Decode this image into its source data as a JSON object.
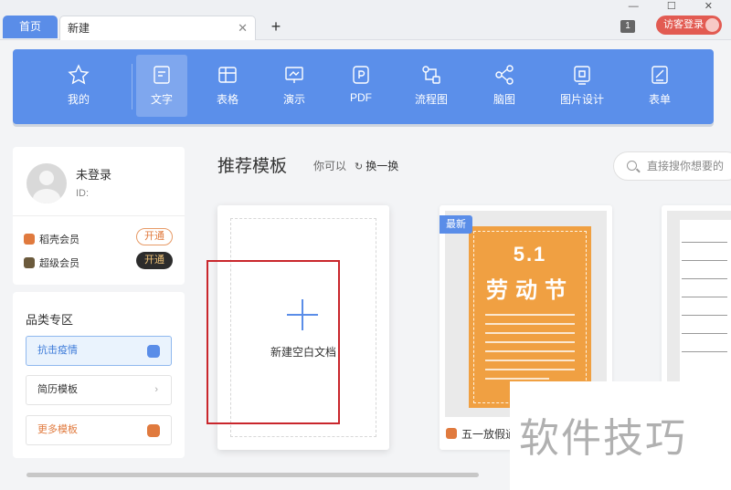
{
  "tabs": {
    "home": "首页",
    "new": "新建",
    "close_glyph": "✕",
    "add_glyph": "+"
  },
  "header": {
    "badge_count": "1",
    "guest_login": "访客登录",
    "window_controls": "— ☐ ✕"
  },
  "toolbar": {
    "items": [
      {
        "label": "我的",
        "icon": "star-icon"
      },
      {
        "label": "文字",
        "icon": "document-icon",
        "active": true
      },
      {
        "label": "表格",
        "icon": "table-icon"
      },
      {
        "label": "演示",
        "icon": "presentation-icon"
      },
      {
        "label": "PDF",
        "icon": "pdf-icon"
      },
      {
        "label": "流程图",
        "icon": "flowchart-icon"
      },
      {
        "label": "脑图",
        "icon": "mindmap-icon"
      },
      {
        "label": "图片设计",
        "icon": "image-design-icon"
      },
      {
        "label": "表单",
        "icon": "form-icon"
      }
    ]
  },
  "user": {
    "name": "未登录",
    "id_label": "ID:",
    "members": [
      {
        "label": "稻壳会员",
        "button": "开通",
        "color": "#e07a3e"
      },
      {
        "label": "超级会员",
        "button": "开通",
        "color": "#6b5a3c"
      }
    ]
  },
  "categories": {
    "title": "品类专区",
    "items": [
      {
        "label": "抗击疫情",
        "active": true
      },
      {
        "label": "简历模板",
        "arrow": "›"
      },
      {
        "label": "更多模板",
        "highlight": true
      }
    ]
  },
  "main": {
    "section_title": "推荐模板",
    "maybe": "你可以",
    "refresh": "换一换",
    "search_placeholder": "直接搜你想要的"
  },
  "templates": {
    "blank_label": "新建空白文档",
    "featured": {
      "badge": "最新",
      "poster_title_1": "5.1",
      "poster_title_2": "劳动节",
      "name": "五一放假通"
    }
  },
  "watermark": "软件技巧",
  "colors": {
    "accent": "#5a8de8",
    "toolbar": "#5b8fea",
    "highlight_box": "#c9262c",
    "poster": "#f0a042",
    "login": "#e25b52"
  }
}
